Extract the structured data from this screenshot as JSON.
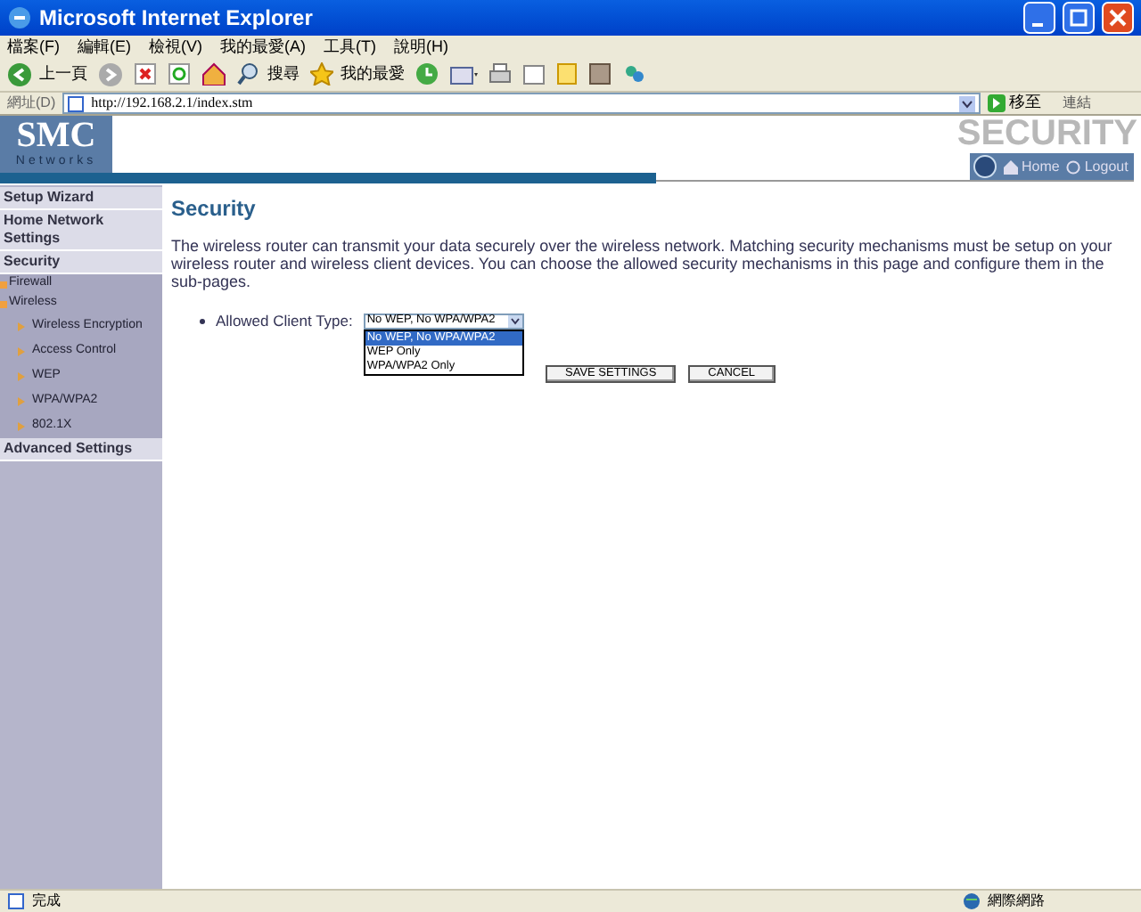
{
  "window": {
    "title": "Microsoft Internet Explorer"
  },
  "menu": [
    "檔案(F)",
    "編輯(E)",
    "檢視(V)",
    "我的最愛(A)",
    "工具(T)",
    "說明(H)"
  ],
  "toolbar": {
    "back": "上一頁",
    "search": "搜尋",
    "favorites": "我的最愛"
  },
  "address_bar": {
    "label": "網址(D)",
    "url": "http://192.168.2.1/index.stm",
    "go": "移至",
    "links": "連結"
  },
  "header": {
    "logo": "SMC",
    "logo_sub": "Networks",
    "section": "SECURITY",
    "home": "Home",
    "logout": "Logout"
  },
  "sidebar": [
    {
      "kind": "header",
      "label": "Setup Wizard"
    },
    {
      "kind": "header",
      "label": "Home Network Settings"
    },
    {
      "kind": "header",
      "label": "Security"
    },
    {
      "kind": "sub",
      "label": "Firewall"
    },
    {
      "kind": "sub",
      "label": "Wireless"
    },
    {
      "kind": "leaf",
      "label": "Wireless Encryption"
    },
    {
      "kind": "leaf",
      "label": "Access Control"
    },
    {
      "kind": "leaf",
      "label": "WEP"
    },
    {
      "kind": "leaf",
      "label": "WPA/WPA2"
    },
    {
      "kind": "leaf",
      "label": "802.1X"
    },
    {
      "kind": "header",
      "label": "Advanced Settings"
    }
  ],
  "main": {
    "title": "Security",
    "description": "The wireless router can transmit your data securely over the wireless network. Matching security mechanisms must be setup on your wireless router and wireless client devices. You can choose the allowed security mechanisms in this page and configure them in the sub-pages.",
    "field_label": "Allowed Client Type:",
    "value": "No WEP, No WPA/WPA2",
    "options": [
      {
        "label": "No WEP, No WPA/WPA2",
        "selected": true
      },
      {
        "label": "WEP Only",
        "selected": false
      },
      {
        "label": "WPA/WPA2 Only",
        "selected": false
      }
    ],
    "buttons": [
      "SAVE SETTINGS",
      "CANCEL"
    ]
  },
  "status_bar": {
    "text": "完成",
    "zone": "網際網路"
  }
}
